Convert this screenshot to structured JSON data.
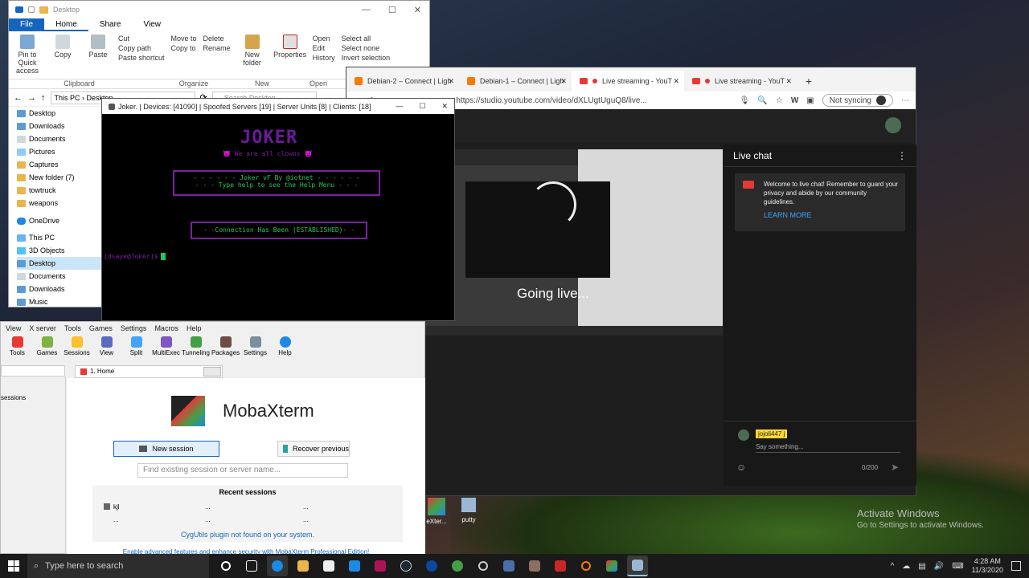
{
  "explorer": {
    "title": "Desktop",
    "tabs": [
      "File",
      "Home",
      "Share",
      "View"
    ],
    "ribbon": {
      "pin": "Pin to Quick access",
      "copy": "Copy",
      "paste": "Paste",
      "cut": "Cut",
      "copy_path": "Copy path",
      "paste_shortcut": "Paste shortcut",
      "move_to": "Move to",
      "copy_to": "Copy to",
      "delete": "Delete",
      "rename": "Rename",
      "new_folder": "New folder",
      "properties": "Properties",
      "open": "Open",
      "edit": "Edit",
      "history": "History",
      "select_all": "Select all",
      "select_none": "Select none",
      "invert_selection": "Invert selection"
    },
    "groups": [
      "Clipboard",
      "Organize",
      "New",
      "Open"
    ],
    "address": [
      "This PC",
      "Desktop"
    ],
    "search_placeholder": "Search Desktop",
    "nav": [
      "Desktop",
      "Downloads",
      "Documents",
      "Pictures",
      "Captures",
      "New folder (7)",
      "towtruck",
      "weapons",
      "OneDrive",
      "This PC",
      "3D Objects",
      "Desktop",
      "Documents",
      "Downloads",
      "Music"
    ]
  },
  "terminal": {
    "title": "Joker. | Devices: [41090] | Spoofed Servers [19] | Server Units [8] | Clients: [18]",
    "logo": "JOKER",
    "tagline": "😈 We are all clowns 😈",
    "banner1": "- - - - - - Joker vF By @iotnet - - - - - -",
    "banner2": "- - - Type help to see the Help Menu - - -",
    "connection": "- -Connection Has Been (ESTABLISHED)- -",
    "prompt": "[dsaye@Joker]$"
  },
  "browser": {
    "tabs": [
      "Debian-2 – Connect | Ligh",
      "Debian-1 – Connect | Ligh",
      "Live streaming - YouT",
      "Live streaming - YouT"
    ],
    "url": "https://studio.youtube.com/video/dXLUgtUguQ8/live...",
    "sync": "Not syncing",
    "going_live": "Going live...",
    "chat": {
      "title": "Live chat",
      "welcome": "Welcome to live chat! Remember to guard your privacy and abide by our community guidelines.",
      "learn_more": "LEARN MORE",
      "user": "jojoli447 j",
      "placeholder": "Say something...",
      "counter": "0/200"
    }
  },
  "moba": {
    "menu": [
      "View",
      "X server",
      "Tools",
      "Games",
      "Settings",
      "Macros",
      "Help"
    ],
    "tools": [
      "Tools",
      "Games",
      "Sessions",
      "View",
      "Split",
      "MultiExec",
      "Tunneling",
      "Packages",
      "Settings",
      "Help"
    ],
    "home_tab": "1. Home",
    "sessions_label": "sessions",
    "brand": "MobaXterm",
    "new_session": "New session",
    "recover": "Recover previous",
    "search_placeholder": "Find existing session or server name...",
    "recent_title": "Recent sessions",
    "recent": [
      "kjl",
      "...",
      "...",
      "...",
      "...",
      "..."
    ],
    "cygutils": "CygUtils plugin not found on your system.",
    "footer": "Enable advanced features and enhance security with MobaXterm Professional Edition!"
  },
  "desktop": {
    "icons": [
      "eXter...",
      "putty"
    ],
    "activate_title": "Activate Windows",
    "activate_sub": "Go to Settings to activate Windows."
  },
  "taskbar": {
    "search": "Type here to search",
    "time": "4:28 AM",
    "date": "11/3/2020"
  }
}
